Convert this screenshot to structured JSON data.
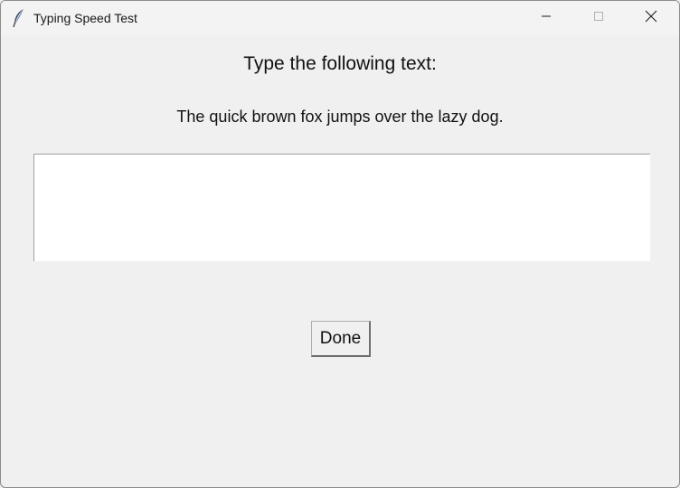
{
  "window": {
    "title": "Typing Speed Test",
    "icons": {
      "app": "feather-icon",
      "minimize": "minimize-icon",
      "maximize": "maximize-icon",
      "close": "close-icon"
    }
  },
  "main": {
    "heading": "Type the following text:",
    "prompt": "The quick brown fox jumps over the lazy dog.",
    "input_value": "",
    "done_label": "Done"
  },
  "colors": {
    "background": "#f0f0f0",
    "input_background": "#ffffff",
    "text": "#111111"
  }
}
